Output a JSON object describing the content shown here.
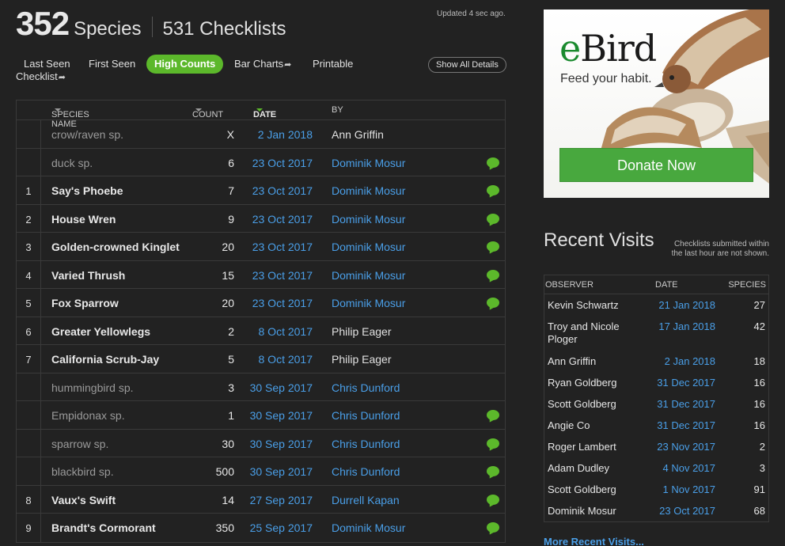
{
  "header": {
    "species_count": "352",
    "species_label": "Species",
    "checklists_label": "531 Checklists",
    "updated": "Updated 4 sec ago."
  },
  "tabs": {
    "last_seen": "Last Seen",
    "first_seen": "First Seen",
    "high_counts": "High Counts",
    "bar_charts": "Bar Charts",
    "printable": "Printable",
    "checklist": "Checklist",
    "show_all": "Show All Details"
  },
  "table": {
    "columns": {
      "species": "SPECIES NAME",
      "count": "COUNT",
      "date": "DATE",
      "by": "BY"
    },
    "rows": [
      {
        "num": "",
        "name": "crow/raven sp.",
        "count": "X",
        "date": "2 Jan 2018",
        "by": "Ann Griffin",
        "by_link": false,
        "comment": false,
        "bold": false
      },
      {
        "num": "",
        "name": "duck sp.",
        "count": "6",
        "date": "23 Oct 2017",
        "by": "Dominik Mosur",
        "by_link": true,
        "comment": true,
        "bold": false
      },
      {
        "num": "1",
        "name": "Say's Phoebe",
        "count": "7",
        "date": "23 Oct 2017",
        "by": "Dominik Mosur",
        "by_link": true,
        "comment": true,
        "bold": true
      },
      {
        "num": "2",
        "name": "House Wren",
        "count": "9",
        "date": "23 Oct 2017",
        "by": "Dominik Mosur",
        "by_link": true,
        "comment": true,
        "bold": true
      },
      {
        "num": "3",
        "name": "Golden-crowned Kinglet",
        "count": "20",
        "date": "23 Oct 2017",
        "by": "Dominik Mosur",
        "by_link": true,
        "comment": true,
        "bold": true
      },
      {
        "num": "4",
        "name": "Varied Thrush",
        "count": "15",
        "date": "23 Oct 2017",
        "by": "Dominik Mosur",
        "by_link": true,
        "comment": true,
        "bold": true
      },
      {
        "num": "5",
        "name": "Fox Sparrow",
        "count": "20",
        "date": "23 Oct 2017",
        "by": "Dominik Mosur",
        "by_link": true,
        "comment": true,
        "bold": true
      },
      {
        "num": "6",
        "name": "Greater Yellowlegs",
        "count": "2",
        "date": "8 Oct 2017",
        "by": "Philip Eager",
        "by_link": false,
        "comment": false,
        "bold": true
      },
      {
        "num": "7",
        "name": "California Scrub-Jay",
        "count": "5",
        "date": "8 Oct 2017",
        "by": "Philip Eager",
        "by_link": false,
        "comment": false,
        "bold": true
      },
      {
        "num": "",
        "name": "hummingbird sp.",
        "count": "3",
        "date": "30 Sep 2017",
        "by": "Chris Dunford",
        "by_link": true,
        "comment": false,
        "bold": false
      },
      {
        "num": "",
        "name": "Empidonax sp.",
        "count": "1",
        "date": "30 Sep 2017",
        "by": "Chris Dunford",
        "by_link": true,
        "comment": true,
        "bold": false
      },
      {
        "num": "",
        "name": "sparrow sp.",
        "count": "30",
        "date": "30 Sep 2017",
        "by": "Chris Dunford",
        "by_link": true,
        "comment": true,
        "bold": false
      },
      {
        "num": "",
        "name": "blackbird sp.",
        "count": "500",
        "date": "30 Sep 2017",
        "by": "Chris Dunford",
        "by_link": true,
        "comment": true,
        "bold": false
      },
      {
        "num": "8",
        "name": "Vaux's Swift",
        "count": "14",
        "date": "27 Sep 2017",
        "by": "Durrell Kapan",
        "by_link": true,
        "comment": true,
        "bold": true
      },
      {
        "num": "9",
        "name": "Brandt's Cormorant",
        "count": "350",
        "date": "25 Sep 2017",
        "by": "Dominik Mosur",
        "by_link": true,
        "comment": true,
        "bold": true
      }
    ]
  },
  "ad": {
    "logo_e": "e",
    "logo_rest": "Bird",
    "tagline": "Feed your habit.",
    "button": "Donate Now",
    "image_icon": "hawk-illustration"
  },
  "recent": {
    "title": "Recent Visits",
    "note": "Checklists submitted within the last hour are not shown.",
    "columns": {
      "observer": "OBSERVER",
      "date": "DATE",
      "species": "SPECIES"
    },
    "rows": [
      {
        "observer": "Kevin Schwartz",
        "date": "21 Jan 2018",
        "species": "27"
      },
      {
        "observer": "Troy and Nicole Ploger",
        "date": "17 Jan 2018",
        "species": "42"
      },
      {
        "observer": "Ann Griffin",
        "date": "2 Jan 2018",
        "species": "18"
      },
      {
        "observer": "Ryan Goldberg",
        "date": "31 Dec 2017",
        "species": "16"
      },
      {
        "observer": "Scott Goldberg",
        "date": "31 Dec 2017",
        "species": "16"
      },
      {
        "observer": "Angie Co",
        "date": "31 Dec 2017",
        "species": "16"
      },
      {
        "observer": "Roger Lambert",
        "date": "23 Nov 2017",
        "species": "2"
      },
      {
        "observer": "Adam Dudley",
        "date": "4 Nov 2017",
        "species": "3"
      },
      {
        "observer": "Scott Goldberg",
        "date": "1 Nov 2017",
        "species": "91"
      },
      {
        "observer": "Dominik Mosur",
        "date": "23 Oct 2017",
        "species": "68"
      }
    ],
    "more": "More Recent Visits..."
  },
  "colors": {
    "background": "#222222",
    "accent_green": "#5cb82b",
    "link_blue": "#4a9fe8"
  }
}
